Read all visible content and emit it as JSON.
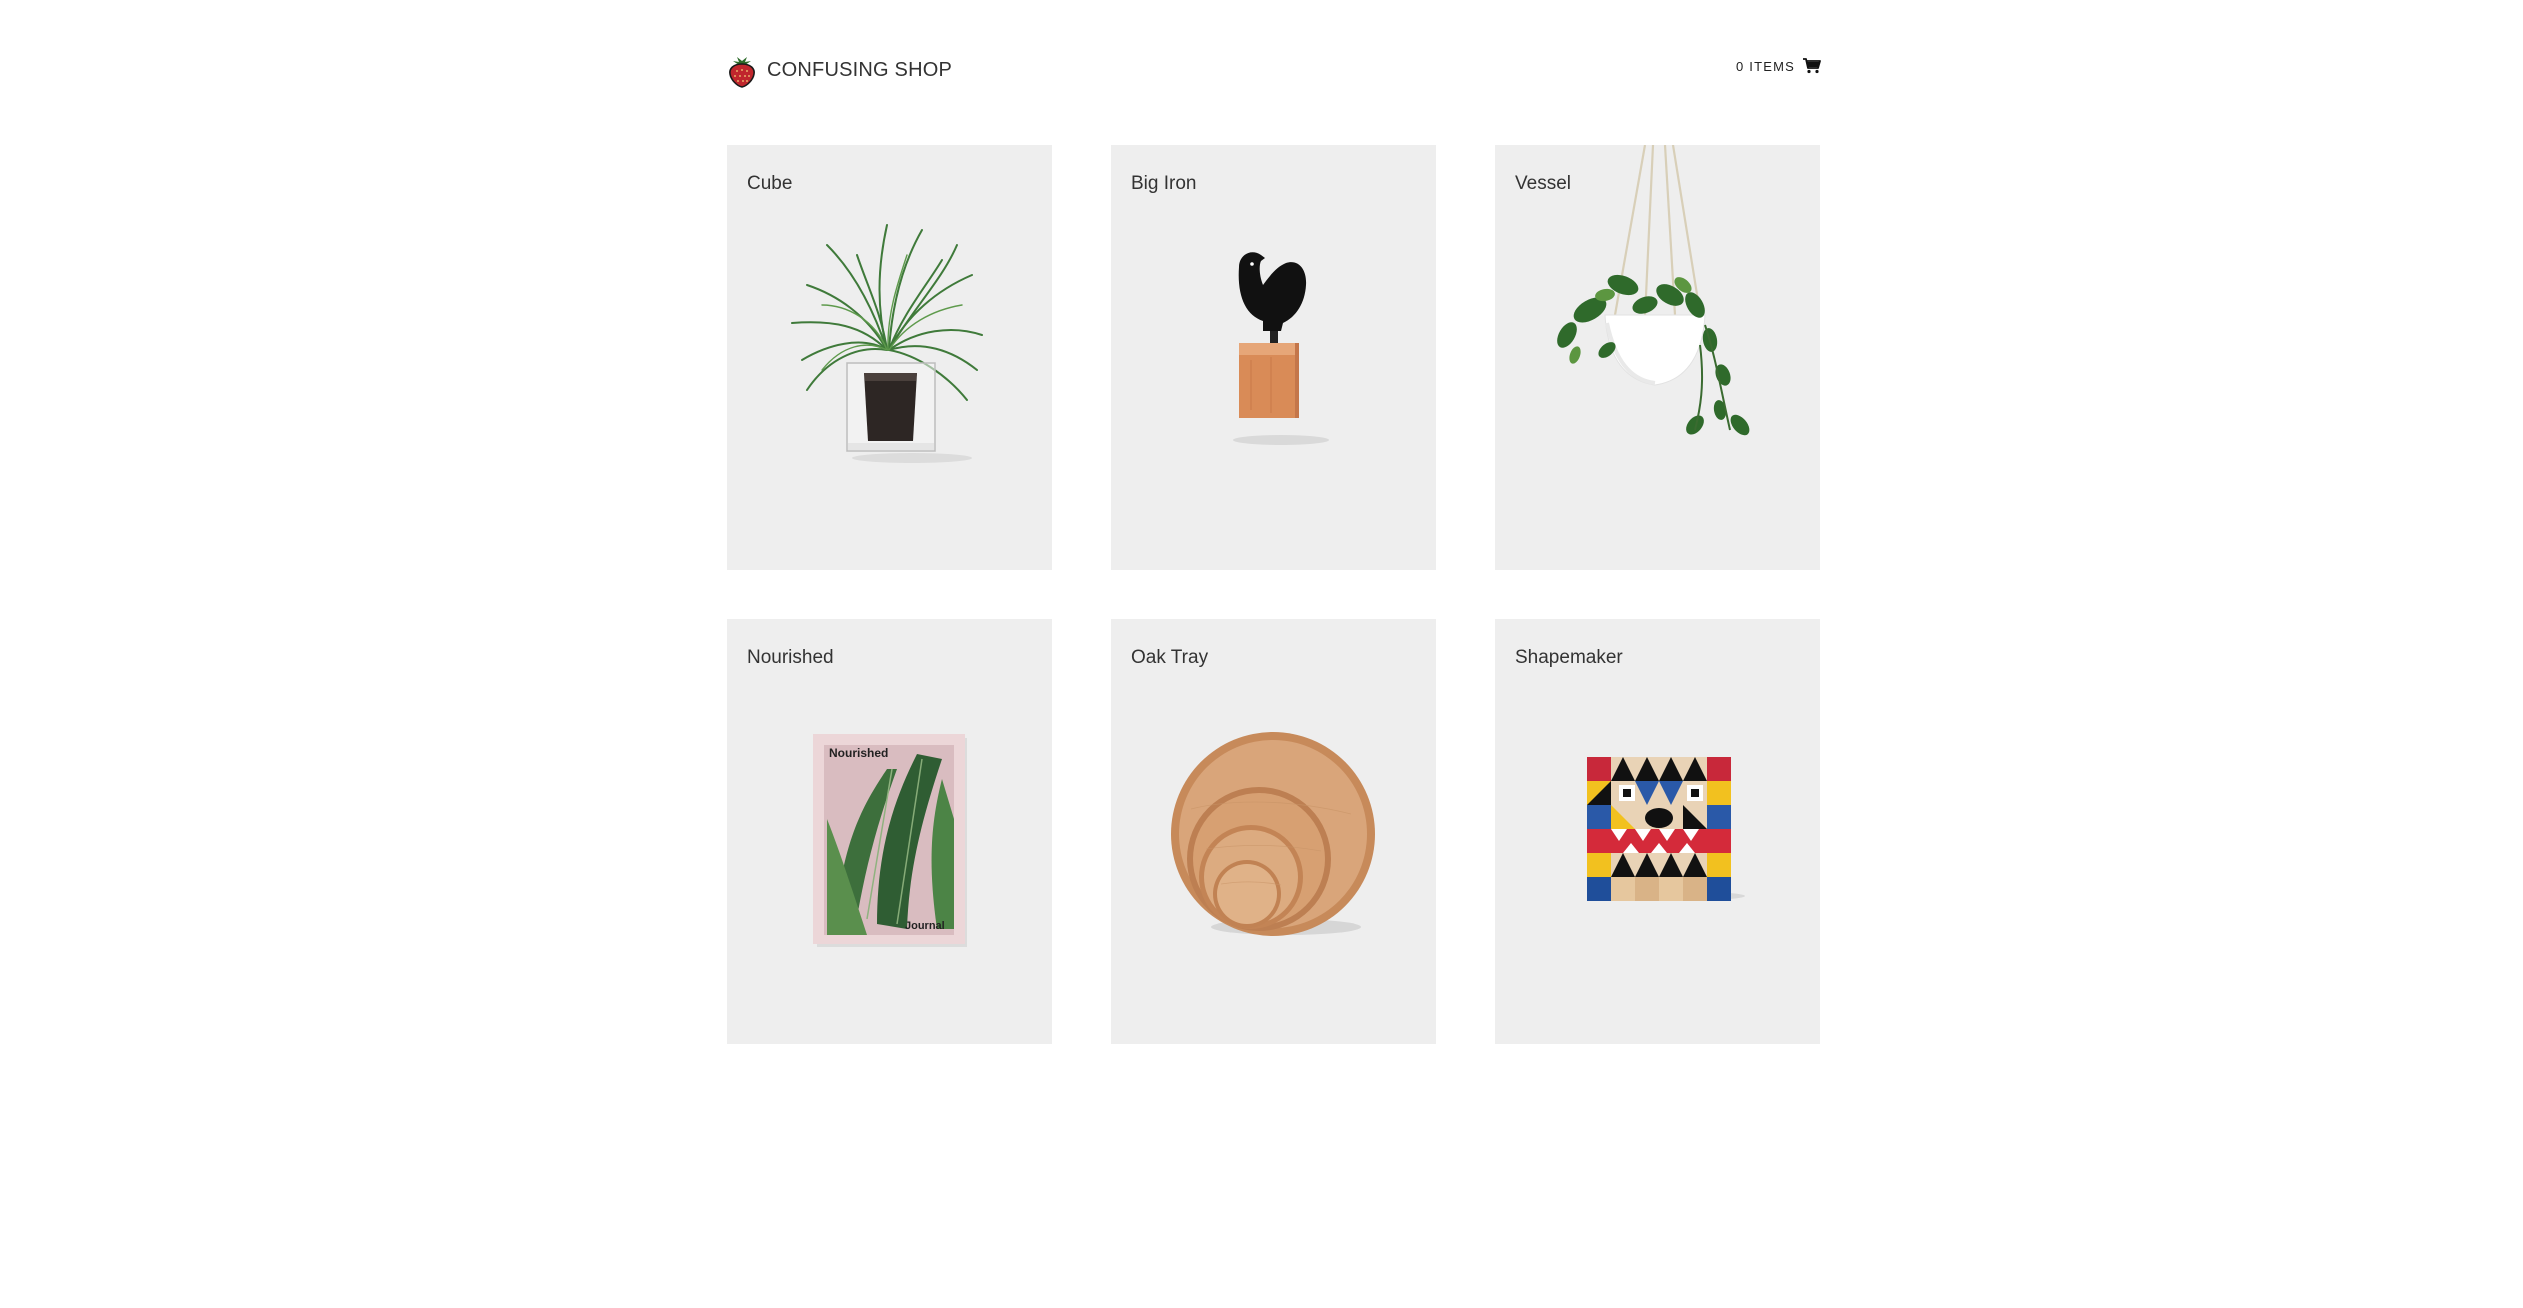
{
  "header": {
    "brand_name": "CONFUSING SHOP",
    "logo_icon": "strawberry-icon",
    "cart_label": "0 ITEMS",
    "cart_icon": "shopping-cart-icon"
  },
  "products": [
    {
      "title": "Cube",
      "image": "potted-plant-in-glass-cube"
    },
    {
      "title": "Big Iron",
      "image": "black-bird-figure-on-wood-block"
    },
    {
      "title": "Vessel",
      "image": "hanging-planter-with-vine"
    },
    {
      "title": "Nourished",
      "image": "magazine-with-banana-leaf-cover"
    },
    {
      "title": "Oak Tray",
      "image": "stacked-round-wooden-trays"
    },
    {
      "title": "Shapemaker",
      "image": "geometric-block-face-puzzle"
    }
  ],
  "magazine_cover": {
    "title": "Nourished",
    "subtitle": "Journal"
  },
  "colors": {
    "card_background": "#eeeeee",
    "text": "#333333",
    "logo_red": "#c0262d"
  }
}
